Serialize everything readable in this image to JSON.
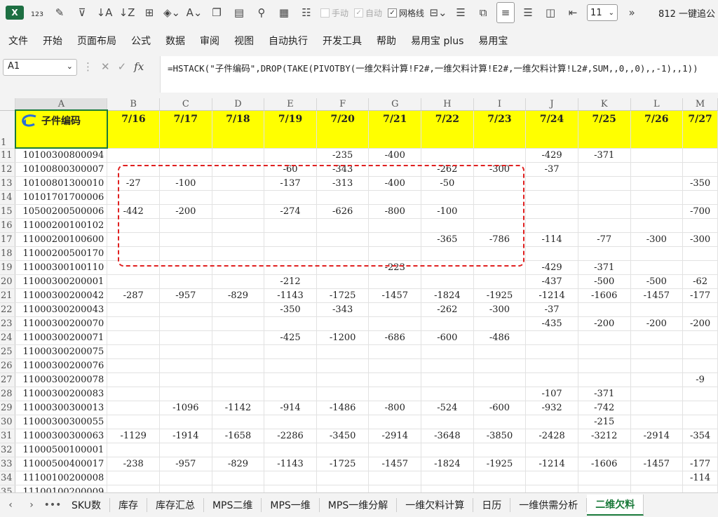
{
  "toolbar": {
    "manual_calc": "手动",
    "auto_calc": "自动",
    "gridlines": "网格线",
    "zoom": "11",
    "more": "»",
    "window_title": "812 一键追公"
  },
  "menu": [
    "文件",
    "开始",
    "页面布局",
    "公式",
    "数据",
    "审阅",
    "视图",
    "自动执行",
    "开发工具",
    "帮助",
    "易用宝 plus",
    "易用宝"
  ],
  "formula_bar": {
    "name_box": "A1",
    "fx": "fx",
    "formula": "=HSTACK(\"子件编码\",DROP(TAKE(PIVOTBY(一维欠料计算!F2#,一维欠料计算!E2#,一维欠料计算!L2#,SUM,,0,,0),,-1),,1))"
  },
  "sheet": {
    "columns": [
      "A",
      "B",
      "C",
      "D",
      "E",
      "F",
      "G",
      "H",
      "I",
      "J",
      "K",
      "L",
      "M"
    ],
    "header_row_num": "1",
    "a1_label": "子件编码",
    "dates": [
      "7/16",
      "7/17",
      "7/18",
      "7/19",
      "7/20",
      "7/21",
      "7/22",
      "7/23",
      "7/24",
      "7/25",
      "7/26",
      "7/27"
    ],
    "rows": [
      {
        "n": "11",
        "code": "10100300800094",
        "v": [
          "",
          "",
          "",
          "",
          "-235",
          "-400",
          "",
          "",
          "-429",
          "-371",
          "",
          ""
        ]
      },
      {
        "n": "12",
        "code": "10100800300007",
        "v": [
          "",
          "",
          "",
          "-60",
          "-343",
          "",
          "-262",
          "-300",
          "-37",
          "",
          "",
          ""
        ]
      },
      {
        "n": "13",
        "code": "10100801300010",
        "v": [
          "-27",
          "-100",
          "",
          "-137",
          "-313",
          "-400",
          "-50",
          "",
          "",
          "",
          "",
          "-350"
        ]
      },
      {
        "n": "14",
        "code": "10101701700006",
        "v": [
          "",
          "",
          "",
          "",
          "",
          "",
          "",
          "",
          "",
          "",
          "",
          ""
        ]
      },
      {
        "n": "15",
        "code": "10500200500006",
        "v": [
          "-442",
          "-200",
          "",
          "-274",
          "-626",
          "-800",
          "-100",
          "",
          "",
          "",
          "",
          "-700"
        ]
      },
      {
        "n": "16",
        "code": "11000200100102",
        "v": [
          "",
          "",
          "",
          "",
          "",
          "",
          "",
          "",
          "",
          "",
          "",
          ""
        ]
      },
      {
        "n": "17",
        "code": "11000200100600",
        "v": [
          "",
          "",
          "",
          "",
          "",
          "",
          "-365",
          "-786",
          "-114",
          "-77",
          "-300",
          "-300"
        ]
      },
      {
        "n": "18",
        "code": "11000200500170",
        "v": [
          "",
          "",
          "",
          "",
          "",
          "",
          "",
          "",
          "",
          "",
          "",
          ""
        ]
      },
      {
        "n": "19",
        "code": "11000300100110",
        "v": [
          "",
          "",
          "",
          "",
          "",
          "-223",
          "",
          "",
          "-429",
          "-371",
          "",
          ""
        ]
      },
      {
        "n": "20",
        "code": "11000300200001",
        "v": [
          "",
          "",
          "",
          "-212",
          "",
          "",
          "",
          "",
          "-437",
          "-500",
          "-500",
          "-62"
        ]
      },
      {
        "n": "21",
        "code": "11000300200042",
        "v": [
          "-287",
          "-957",
          "-829",
          "-1143",
          "-1725",
          "-1457",
          "-1824",
          "-1925",
          "-1214",
          "-1606",
          "-1457",
          "-177"
        ]
      },
      {
        "n": "22",
        "code": "11000300200043",
        "v": [
          "",
          "",
          "",
          "-350",
          "-343",
          "",
          "-262",
          "-300",
          "-37",
          "",
          "",
          ""
        ]
      },
      {
        "n": "23",
        "code": "11000300200070",
        "v": [
          "",
          "",
          "",
          "",
          "",
          "",
          "",
          "",
          "-435",
          "-200",
          "-200",
          "-200"
        ]
      },
      {
        "n": "24",
        "code": "11000300200071",
        "v": [
          "",
          "",
          "",
          "-425",
          "-1200",
          "-686",
          "-600",
          "-486",
          "",
          "",
          "",
          ""
        ]
      },
      {
        "n": "25",
        "code": "11000300200075",
        "v": [
          "",
          "",
          "",
          "",
          "",
          "",
          "",
          "",
          "",
          "",
          "",
          ""
        ]
      },
      {
        "n": "26",
        "code": "11000300200076",
        "v": [
          "",
          "",
          "",
          "",
          "",
          "",
          "",
          "",
          "",
          "",
          "",
          ""
        ]
      },
      {
        "n": "27",
        "code": "11000300200078",
        "v": [
          "",
          "",
          "",
          "",
          "",
          "",
          "",
          "",
          "",
          "",
          "",
          "-9"
        ]
      },
      {
        "n": "28",
        "code": "11000300200083",
        "v": [
          "",
          "",
          "",
          "",
          "",
          "",
          "",
          "",
          "-107",
          "-371",
          "",
          ""
        ]
      },
      {
        "n": "29",
        "code": "11000300300013",
        "v": [
          "",
          "-1096",
          "-1142",
          "-914",
          "-1486",
          "-800",
          "-524",
          "-600",
          "-932",
          "-742",
          "",
          ""
        ]
      },
      {
        "n": "30",
        "code": "11000300300055",
        "v": [
          "",
          "",
          "",
          "",
          "",
          "",
          "",
          "",
          "",
          "-215",
          "",
          ""
        ]
      },
      {
        "n": "31",
        "code": "11000300300063",
        "v": [
          "-1129",
          "-1914",
          "-1658",
          "-2286",
          "-3450",
          "-2914",
          "-3648",
          "-3850",
          "-2428",
          "-3212",
          "-2914",
          "-354"
        ]
      },
      {
        "n": "32",
        "code": "11000500100001",
        "v": [
          "",
          "",
          "",
          "",
          "",
          "",
          "",
          "",
          "",
          "",
          "",
          ""
        ]
      },
      {
        "n": "33",
        "code": "11000500400017",
        "v": [
          "-238",
          "-957",
          "-829",
          "-1143",
          "-1725",
          "-1457",
          "-1824",
          "-1925",
          "-1214",
          "-1606",
          "-1457",
          "-177"
        ]
      },
      {
        "n": "34",
        "code": "11100100200008",
        "v": [
          "",
          "",
          "",
          "",
          "",
          "",
          "",
          "",
          "",
          "",
          "",
          "-114"
        ]
      },
      {
        "n": "35",
        "code": "11100100200009",
        "v": [
          "",
          "",
          "",
          "",
          "",
          "",
          "",
          "",
          "",
          "",
          "",
          ""
        ]
      }
    ]
  },
  "tabs": {
    "more": "•••",
    "items": [
      "SKU数",
      "库存",
      "库存汇总",
      "MPS二维",
      "MPS一维",
      "MPS一维分解",
      "一维欠料计算",
      "日历",
      "一维供需分析",
      "二维欠料"
    ],
    "active_index": 9
  },
  "colors": {
    "header_fill": "#ffff00",
    "selection_border": "#1a7a3a",
    "annotation": "#e02020"
  }
}
